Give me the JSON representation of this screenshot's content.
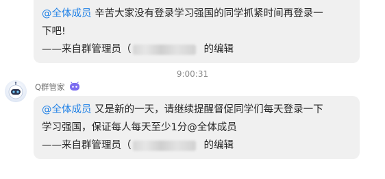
{
  "messages": [
    {
      "mention": "@全体成员",
      "line1_text": " 辛苦大家没有登录学习强国的同学抓紧时间再登录一",
      "line2_text": "下吧!",
      "signature_prefix": "——来自群管理员（",
      "signature_suffix": "的编辑"
    },
    {
      "sender": "Q群管家",
      "mention": "@全体成员",
      "line1_text": " 又是新的一天，请继续提醒督促同学们每天登录一下",
      "line2_text": "学习强国，保证每人每天至少1分@全体成员",
      "signature_prefix": "——来自群管理员（",
      "signature_suffix": "的编辑"
    }
  ],
  "timestamp": "9:00:31",
  "icons": {
    "avatar": "robot-avatar-icon",
    "badge": "bot-badge-icon"
  },
  "colors": {
    "mention": "#1e80e6",
    "bubble": "#f0f0f0",
    "badge": "#7b6cf0"
  }
}
